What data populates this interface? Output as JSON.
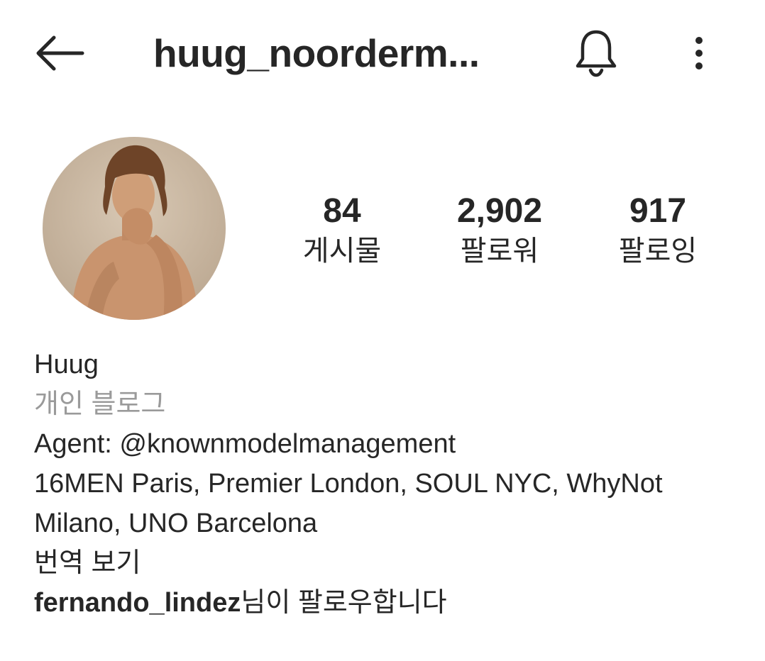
{
  "header": {
    "title": "huug_noorderm...",
    "back_icon": "arrow-left-icon",
    "notification_icon": "bell-icon",
    "more_icon": "more-vertical-icon"
  },
  "profile": {
    "avatar_icon": "profile-photo",
    "stats": [
      {
        "value": "84",
        "label": "게시물"
      },
      {
        "value": "2,902",
        "label": "팔로워"
      },
      {
        "value": "917",
        "label": "팔로잉"
      }
    ]
  },
  "bio": {
    "name": "Huug",
    "category": "개인 블로그",
    "agent_prefix": "Agent: ",
    "agent_mention": "@knownmodelmanagement",
    "line1": "16MEN Paris, Premier London, SOUL NYC, WhyNot",
    "line2": "Milano, UNO Barcelona",
    "translate": "번역 보기",
    "followed_by_user": "fernando_lindez",
    "followed_by_suffix": "님이 팔로우합니다"
  },
  "colors": {
    "text": "#262626",
    "secondary": "#9a9a9a",
    "background": "#ffffff"
  }
}
